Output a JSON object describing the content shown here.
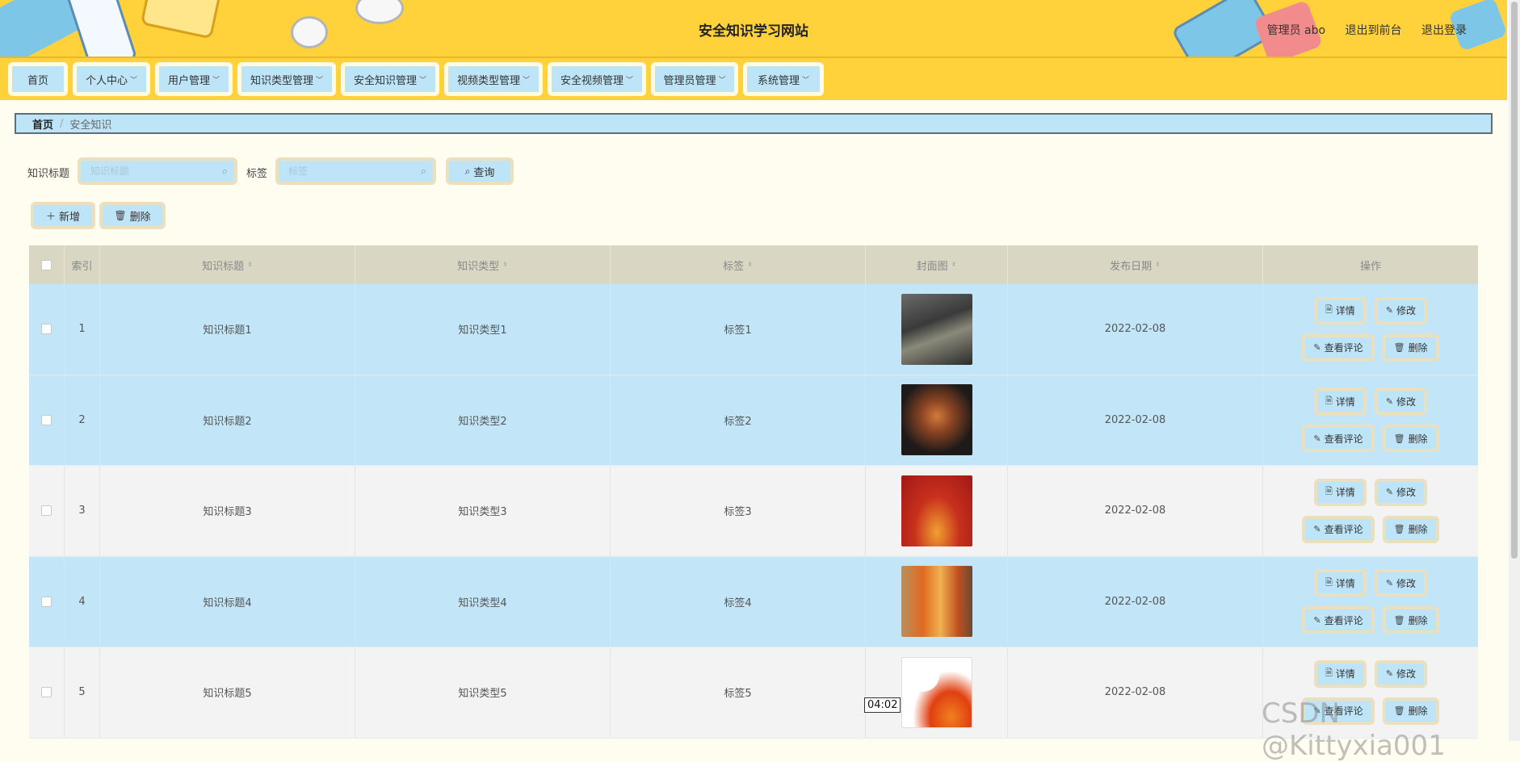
{
  "header": {
    "title": "安全知识学习网站",
    "user": "管理员 abo",
    "to_front": "退出到前台",
    "logout": "退出登录"
  },
  "nav": [
    {
      "label": "首页"
    },
    {
      "label": "个人中心"
    },
    {
      "label": "用户管理"
    },
    {
      "label": "知识类型管理"
    },
    {
      "label": "安全知识管理"
    },
    {
      "label": "视频类型管理"
    },
    {
      "label": "安全视频管理"
    },
    {
      "label": "管理员管理"
    },
    {
      "label": "系统管理"
    }
  ],
  "breadcrumb": {
    "home": "首页",
    "current": "安全知识",
    "sep": "/"
  },
  "search": {
    "title_label": "知识标题",
    "title_placeholder": "知识标题",
    "tag_label": "标签",
    "tag_placeholder": "标签",
    "query_button": "查询"
  },
  "actions": {
    "add": "新增",
    "delete": "删除"
  },
  "table": {
    "headers": [
      "索引",
      "知识标题",
      "知识类型",
      "标签",
      "封面图",
      "发布日期",
      "操作"
    ],
    "rows": [
      {
        "index": "1",
        "title": "知识标题1",
        "type": "知识类型1",
        "tag": "标签1",
        "date": "2022-02-08"
      },
      {
        "index": "2",
        "title": "知识标题2",
        "type": "知识类型2",
        "tag": "标签2",
        "date": "2022-02-08"
      },
      {
        "index": "3",
        "title": "知识标题3",
        "type": "知识类型3",
        "tag": "标签3",
        "date": "2022-02-08"
      },
      {
        "index": "4",
        "title": "知识标题4",
        "type": "知识类型4",
        "tag": "标签4",
        "date": "2022-02-08"
      },
      {
        "index": "5",
        "title": "知识标题5",
        "type": "知识类型5",
        "tag": "标签5",
        "date": "2022-02-08"
      }
    ],
    "row_ops": {
      "detail": "详情",
      "edit": "修改",
      "comments": "查看评论",
      "delete": "删除"
    }
  },
  "tooltip": "04:02",
  "watermark": "CSDN @Kittyxia001",
  "colors": {
    "header_yellow": "#ffd23c",
    "button_blue": "#bde4f7",
    "row_blue": "#c2e6f8"
  }
}
